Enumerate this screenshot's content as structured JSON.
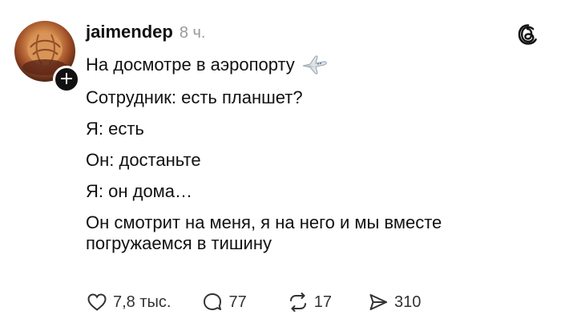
{
  "post": {
    "author": {
      "username": "jaimendep",
      "time": "8 ч."
    },
    "lines": [
      "На досмотре в аэропорту",
      "Сотрудник: есть планшет?",
      "Я: есть",
      "Он: достаньте",
      "Я: он дома…",
      "Он смотрит на меня, я на него и мы вместе погружаемся в тишину"
    ],
    "emoji": "airplane",
    "stats": {
      "likes": "7,8 тыс.",
      "replies": "77",
      "reposts": "17",
      "shares": "310"
    }
  },
  "icons": {
    "app": "threads-logo-icon",
    "like": "heart-icon",
    "reply": "comment-bubble-icon",
    "repost": "repost-arrows-icon",
    "share": "send-icon",
    "follow": "plus-icon"
  }
}
